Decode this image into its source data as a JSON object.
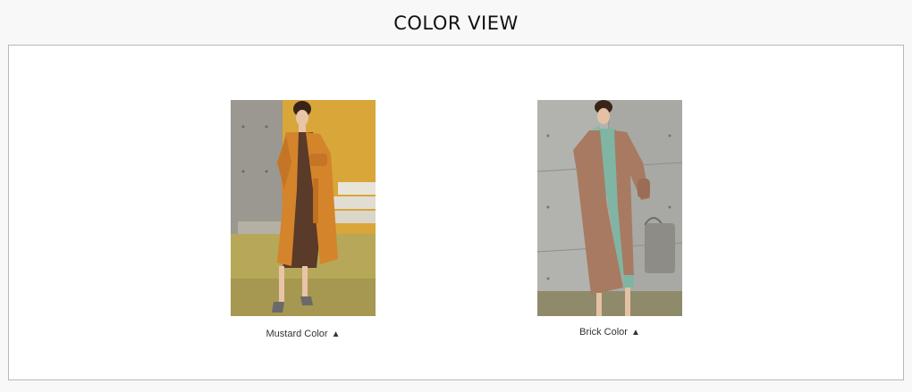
{
  "section": {
    "title": "COLOR VIEW"
  },
  "products": [
    {
      "caption": "Mustard Color",
      "arrow_icon": "triangle-up-icon",
      "coat_color": "#d4842a"
    },
    {
      "caption": "Brick Color",
      "arrow_icon": "triangle-up-icon",
      "coat_color": "#a87a62"
    }
  ]
}
